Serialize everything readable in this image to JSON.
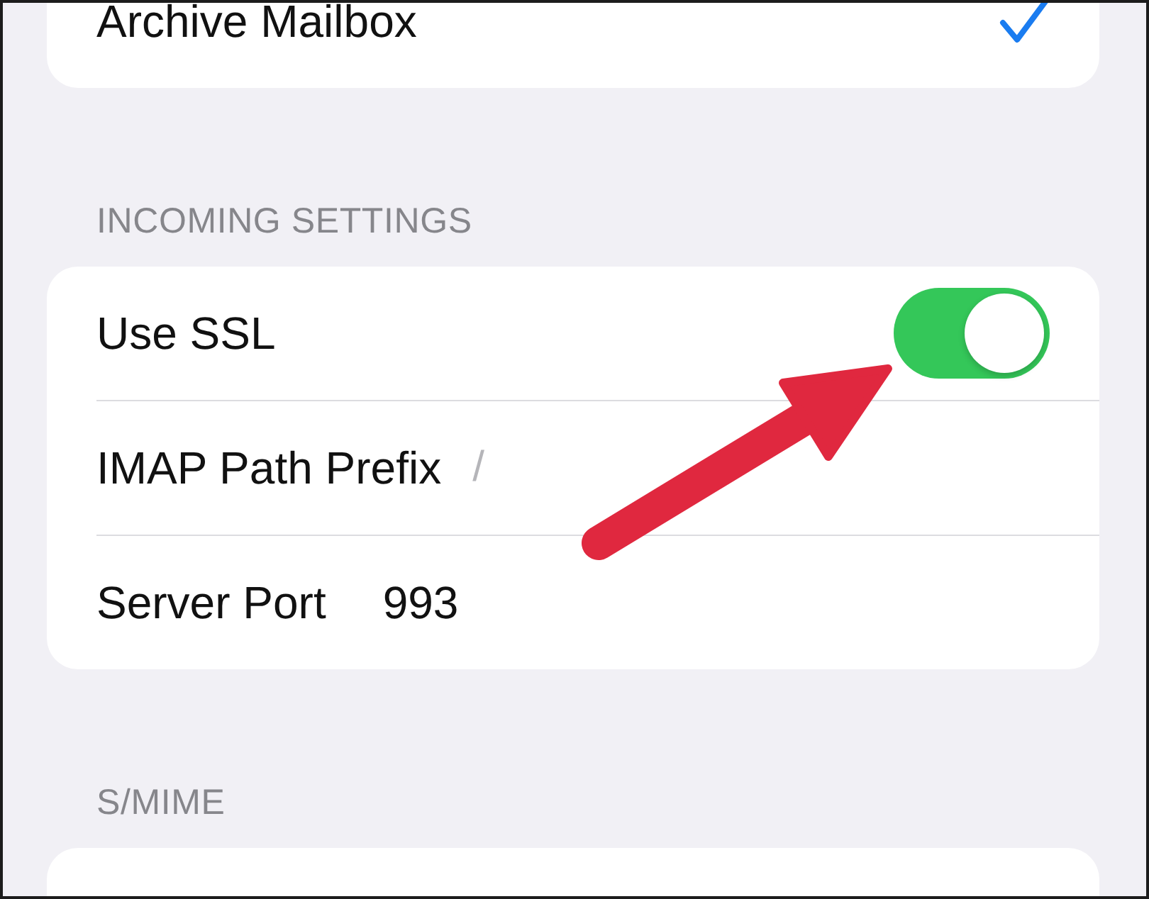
{
  "sections": [
    {
      "rows": [
        {
          "kind": "check",
          "label": "Archive Mailbox",
          "checked": true
        }
      ]
    },
    {
      "header": "INCOMING SETTINGS",
      "rows": [
        {
          "kind": "toggle",
          "label": "Use SSL",
          "on": true
        },
        {
          "kind": "value",
          "label": "IMAP Path Prefix",
          "value": "/",
          "muted": true
        },
        {
          "kind": "value",
          "label": "Server Port",
          "value": "993",
          "muted": false
        }
      ]
    },
    {
      "header": "S/MIME"
    }
  ]
}
